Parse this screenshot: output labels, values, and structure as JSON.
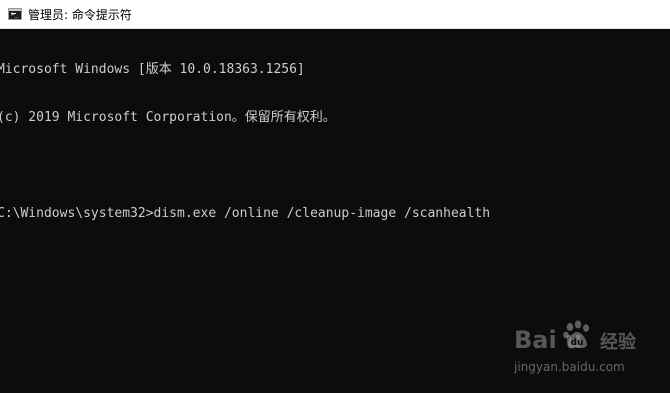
{
  "window": {
    "title": "管理员: 命令提示符",
    "icon": "cmd-icon"
  },
  "console": {
    "lines": [
      "Microsoft Windows [版本 10.0.18363.1256]",
      "(c) 2019 Microsoft Corporation。保留所有权利。",
      "",
      "C:\\Windows\\system32>dism.exe /online /cleanup-image /scanhealth"
    ]
  },
  "watermark": {
    "brand": "Bai  u",
    "sub": "经验",
    "url": "jingyan.baidu.com",
    "icon": "baidu-paw-icon"
  },
  "colors": {
    "console_bg": "#0c0c0c",
    "console_text": "#cccccc",
    "titlebar_bg": "#ffffff"
  }
}
